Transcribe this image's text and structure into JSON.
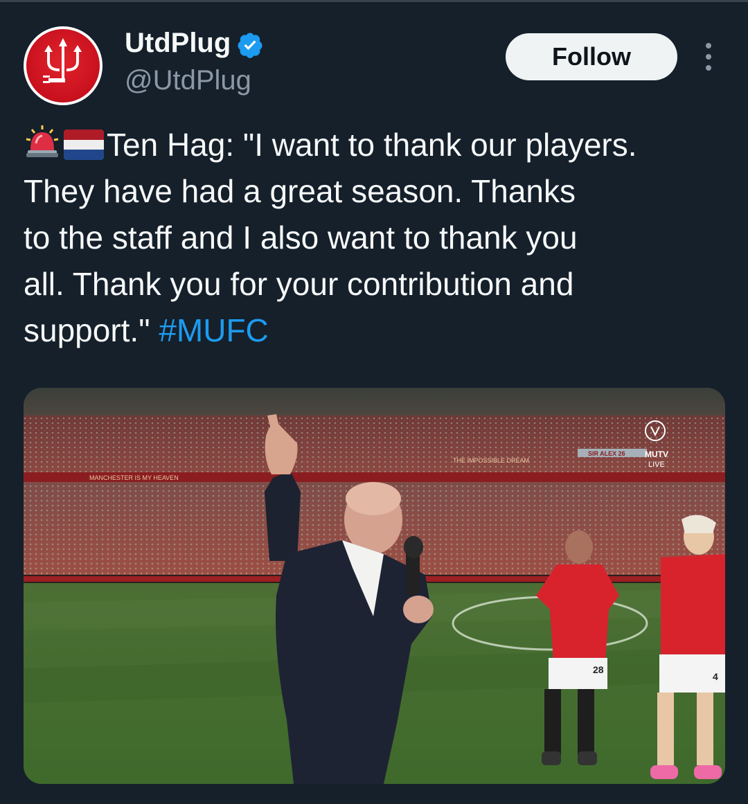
{
  "author": {
    "display_name": "UtdPlug",
    "handle": "@UtdPlug",
    "verified": true,
    "avatar_icon": "trident-icon"
  },
  "actions": {
    "follow_label": "Follow",
    "more_icon": "more-vertical-icon"
  },
  "tweet": {
    "emojis": [
      "rotating-light-icon",
      "netherlands-flag-icon"
    ],
    "lines": [
      "Ten Hag: \"I want to thank our players.",
      "They have had a great season. Thanks",
      "to the staff and I also want to thank you",
      "all. Thank you for your contribution and",
      "support.\""
    ],
    "hashtag": "#MUFC"
  },
  "media": {
    "overlay_badge": "MUTV",
    "overlay_sub": "LIVE",
    "stand_banner": "SIR ALEX 26",
    "banner_left": "MANCHESTER IS MY HEAVEN",
    "banner_mid": "THE IMPOSSIBLE DREAM",
    "shirt_number_left": "28",
    "shirt_number_right": "4"
  },
  "colors": {
    "background": "#15202b",
    "text": "#f7f9f9",
    "secondary": "#8b98a5",
    "link": "#1d9bf0",
    "verified": "#1d9bf0",
    "follow_bg": "#eff3f4"
  }
}
